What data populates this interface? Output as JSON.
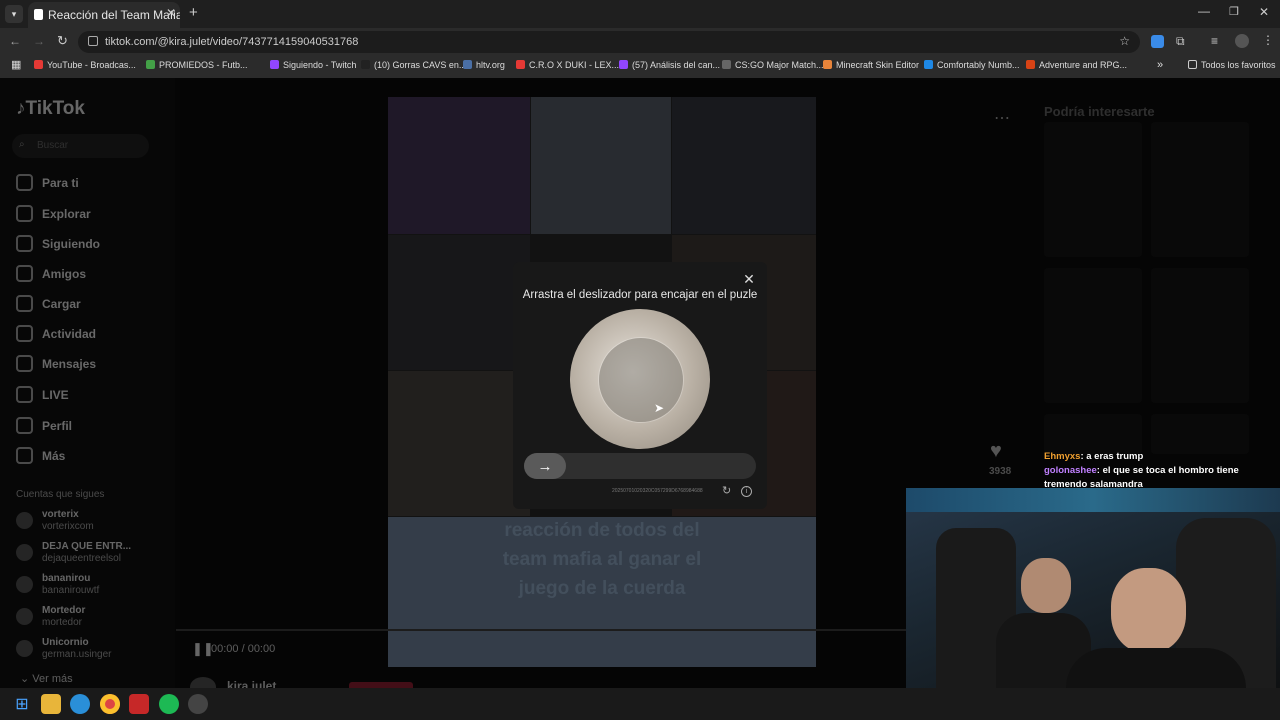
{
  "browser": {
    "tab_title": "Reacción del Team Mafia al Gan",
    "url": "tiktok.com/@kira.julet/video/7437714159040531768",
    "bookmarks": [
      {
        "label": "YouTube - Broadcas...",
        "color": "#e53935"
      },
      {
        "label": "PROMIEDOS - Futb...",
        "color": "#43a047"
      },
      {
        "label": "Siguiendo - Twitch",
        "color": "#9146ff"
      },
      {
        "label": "(10) Gorras CAVS en...",
        "color": "#222222"
      },
      {
        "label": "hltv.org",
        "color": "#4a6fa5"
      },
      {
        "label": "C.R.O X DUKI - LEX...",
        "color": "#e53935"
      },
      {
        "label": "(57) Análisis del can...",
        "color": "#9146ff"
      },
      {
        "label": "CS:GO Major Match...",
        "color": "#666666"
      },
      {
        "label": "Minecraft Skin Editor",
        "color": "#e8843a"
      },
      {
        "label": "Comfortably Numb...",
        "color": "#1e88e5"
      },
      {
        "label": "Adventure and RPG...",
        "color": "#d84315"
      }
    ],
    "all_bookmarks": "Todos los favoritos"
  },
  "tiktok": {
    "logo": "TikTok",
    "search_placeholder": "Buscar",
    "nav": [
      "Para ti",
      "Explorar",
      "Siguiendo",
      "Amigos",
      "Cargar",
      "Actividad",
      "Mensajes",
      "LIVE",
      "Perfil",
      "Más"
    ],
    "following_header": "Cuentas que sigues",
    "following": [
      {
        "name": "vorterix",
        "handle": "vorterixcom"
      },
      {
        "name": "DEJA QUE ENTR...",
        "handle": "dejaqueentreelsol"
      },
      {
        "name": "bananirou",
        "handle": "bananirouwtf"
      },
      {
        "name": "Mortedor",
        "handle": "mortedor"
      },
      {
        "name": "Unicornio",
        "handle": "german.usinger"
      }
    ],
    "see_more": "Ver más",
    "suggest_title": "Podría interesarte",
    "like_count": "3938",
    "video_caption": [
      "reacción de todos del",
      "team mafia al ganar el",
      "juego de la cuerda"
    ],
    "time": "00:00 / 00:00",
    "author": "kira.julet"
  },
  "captcha": {
    "title": "Arrastra el deslizador para encajar en el puzle",
    "id": "20250701020320C057299D6768984688",
    "slider_arrow": "→"
  },
  "stream_chat": [
    {
      "user": "Ehmyxs",
      "user_color": "#f0a030",
      "message": ": a eras trump"
    },
    {
      "user": "golonashee",
      "user_color": "#c080ff",
      "message": ": el que se toca el hombro tiene tremendo salamandra"
    }
  ]
}
